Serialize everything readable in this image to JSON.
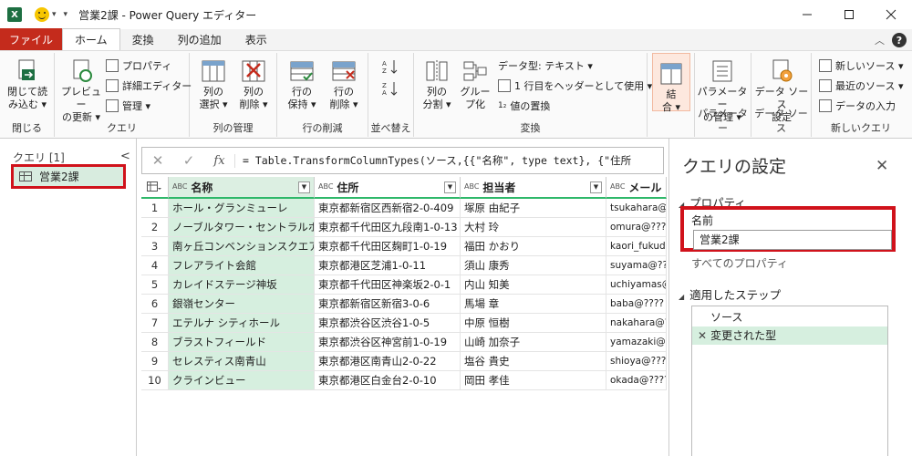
{
  "window": {
    "title": "営業2課 - Power Query エディター",
    "app_badge": "X",
    "qat_dropdown": "▾",
    "qat_more": "▾"
  },
  "menu": {
    "file": "ファイル",
    "tabs": [
      "ホーム",
      "変換",
      "列の追加",
      "表示"
    ],
    "active_tab": "ホーム",
    "help": "?"
  },
  "ribbon": {
    "groups": {
      "close": "閉じる",
      "query": "クエリ",
      "manage_columns": "列の管理",
      "reduce_rows": "行の削減",
      "sort": "並べ替え",
      "transform": "変換",
      "combine": "",
      "parameters": "パラメーター",
      "data_sources": "データ ソース",
      "new_query": "新しいクエリ"
    },
    "close_load": [
      "閉じて読",
      "み込む ▾"
    ],
    "preview_refresh": [
      "プレビュー",
      "の更新 ▾"
    ],
    "properties": "プロパティ",
    "advanced_editor": "詳細エディター",
    "manage": "管理 ▾",
    "choose_columns": [
      "列の",
      "選択 ▾"
    ],
    "remove_columns": [
      "列の",
      "削除 ▾"
    ],
    "keep_rows": [
      "行の",
      "保持 ▾"
    ],
    "remove_rows": [
      "行の",
      "削除 ▾"
    ],
    "split_column": [
      "列の",
      "分割 ▾"
    ],
    "group_by": [
      "グルー",
      "プ化"
    ],
    "data_type": "データ型: テキスト ▾",
    "first_row_header": "1 行目をヘッダーとして使用 ▾",
    "replace_values": "値の置換",
    "combine": [
      "結",
      "合 ▾"
    ],
    "manage_parameters": [
      "パラメーター",
      "の管理 ▾"
    ],
    "data_source_settings": [
      "データ ソース",
      "設定"
    ],
    "new_source": "新しいソース ▾",
    "recent_sources": "最近のソース ▾",
    "enter_data": "データの入力"
  },
  "left_pane": {
    "title": "クエリ [1]",
    "collapse": "<",
    "items": [
      {
        "label": "営業2課"
      }
    ]
  },
  "formula_bar": {
    "cancel": "✕",
    "commit": "✓",
    "fx": "fx",
    "formula": "= Table.TransformColumnTypes(ソース,{{\"名称\", type text}, {\"住所"
  },
  "table": {
    "type_badge": "ABC",
    "columns": [
      "名称",
      "住所",
      "担当者",
      "メール"
    ],
    "rows": [
      [
        "1",
        "ホール・グランミューレ",
        "東京都新宿区西新宿2-0-409",
        "塚原 由紀子",
        "tsukahara@????"
      ],
      [
        "2",
        "ノーブルタワー・セントラルホ…",
        "東京都千代田区九段南1-0-13",
        "大村 玲",
        "omura@????"
      ],
      [
        "3",
        "南ヶ丘コンベンションスクエア",
        "東京都千代田区麹町1-0-19",
        "福田 かおり",
        "kaori_fukuda"
      ],
      [
        "4",
        "フレアライト会館",
        "東京都港区芝浦1-0-11",
        "須山 康秀",
        "suyama@????"
      ],
      [
        "5",
        "カレイドステージ神坂",
        "東京都千代田区神楽坂2-0-1",
        "内山 知美",
        "uchiyamas@"
      ],
      [
        "6",
        "銀嶺センター",
        "東京都新宿区新宿3-0-6",
        "馬場 章",
        "baba@????"
      ],
      [
        "7",
        "エテルナ シティホール",
        "東京都渋谷区渋谷1-0-5",
        "中原 恒樹",
        "nakahara@?"
      ],
      [
        "8",
        "ブラストフィールド",
        "東京都渋谷区神宮前1-0-19",
        "山崎 加奈子",
        "yamazaki@?"
      ],
      [
        "9",
        "セレスティス南青山",
        "東京都港区南青山2-0-22",
        "塩谷 貴史",
        "shioya@????"
      ],
      [
        "10",
        "クラインビュー",
        "東京都港区白金台2-0-10",
        "岡田 孝佳",
        "okada@????"
      ]
    ]
  },
  "right_pane": {
    "title": "クエリの設定",
    "close": "✕",
    "properties_section": "プロパティ",
    "name_label": "名前",
    "name_value": "営業2課",
    "all_properties": "すべてのプロパティ",
    "steps_section": "適用したステップ",
    "steps": [
      "ソース",
      "変更された型"
    ],
    "selected_step_marker": "✕"
  },
  "colors": {
    "file_tab": "#c42b1c",
    "accent_green": "#2fb86a",
    "selection_green": "#d6efdf",
    "highlight_red": "#d0121b"
  }
}
